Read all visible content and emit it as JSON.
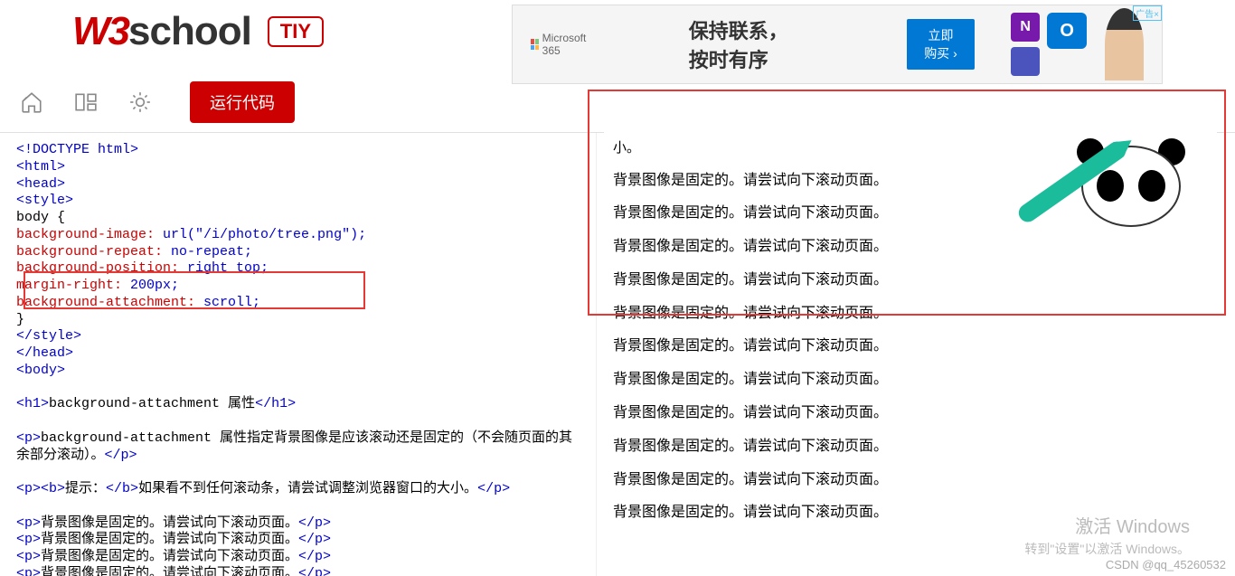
{
  "header": {
    "logo_w3": "W3",
    "logo_school": "school",
    "tiy": "TIY"
  },
  "ad": {
    "brand": "Microsoft 365",
    "headline": "保持联系，按时有序",
    "cta": "立即购买 ›",
    "label": "广告×"
  },
  "toolbar": {
    "run_label": "运行代码"
  },
  "code": {
    "lines": [
      {
        "t": "tag",
        "c": "<!DOCTYPE html>"
      },
      {
        "t": "tag",
        "c": "<html>"
      },
      {
        "t": "tag",
        "c": "<head>"
      },
      {
        "t": "tag",
        "c": "<style>"
      },
      {
        "t": "text",
        "c": "body {"
      },
      {
        "t": "css",
        "p": "  background-image",
        "v": " url(\"/i/photo/tree.png\")"
      },
      {
        "t": "css",
        "p": "  background-repeat",
        "v": " no-repeat"
      },
      {
        "t": "css",
        "p": "  background-position",
        "v": " right top"
      },
      {
        "t": "css",
        "p": "  margin-right",
        "v": " 200px"
      },
      {
        "t": "css",
        "p": "  background-attachment",
        "v": " scroll"
      },
      {
        "t": "text",
        "c": "}"
      },
      {
        "t": "tag",
        "c": "</style>"
      },
      {
        "t": "tag",
        "c": "</head>"
      },
      {
        "t": "tag",
        "c": "<body>"
      },
      {
        "t": "blank",
        "c": ""
      },
      {
        "t": "h1",
        "open": "<h1>",
        "content": "background-attachment 属性",
        "close": "</h1>"
      },
      {
        "t": "blank",
        "c": ""
      },
      {
        "t": "p",
        "open": "<p>",
        "content": "background-attachment 属性指定背景图像是应该滚动还是固定的（不会随页面的其余部分滚动）。",
        "close": "</p>"
      },
      {
        "t": "blank",
        "c": ""
      },
      {
        "t": "pb",
        "open": "<p><b>",
        "label": "提示：",
        "mid": "</b>",
        "content": "如果看不到任何滚动条，请尝试调整浏览器窗口的大小。",
        "close": "</p>"
      },
      {
        "t": "blank",
        "c": ""
      },
      {
        "t": "p",
        "open": "<p>",
        "content": "背景图像是固定的。请尝试向下滚动页面。",
        "close": "</p>"
      },
      {
        "t": "p",
        "open": "<p>",
        "content": "背景图像是固定的。请尝试向下滚动页面。",
        "close": "</p>"
      },
      {
        "t": "p",
        "open": "<p>",
        "content": "背景图像是固定的。请尝试向下滚动页面。",
        "close": "</p>"
      },
      {
        "t": "p",
        "open": "<p>",
        "content": "背景图像是固定的。请尝试向下滚动页面。",
        "close": "</p>"
      }
    ]
  },
  "preview": {
    "tip_partial": "小。",
    "repeat_line": "背景图像是固定的。请尝试向下滚动页面。",
    "repeat_count": 11
  },
  "watermark": {
    "line1": "激活 Windows",
    "line2": "转到\"设置\"以激活 Windows。",
    "credit": "CSDN @qq_45260532"
  }
}
